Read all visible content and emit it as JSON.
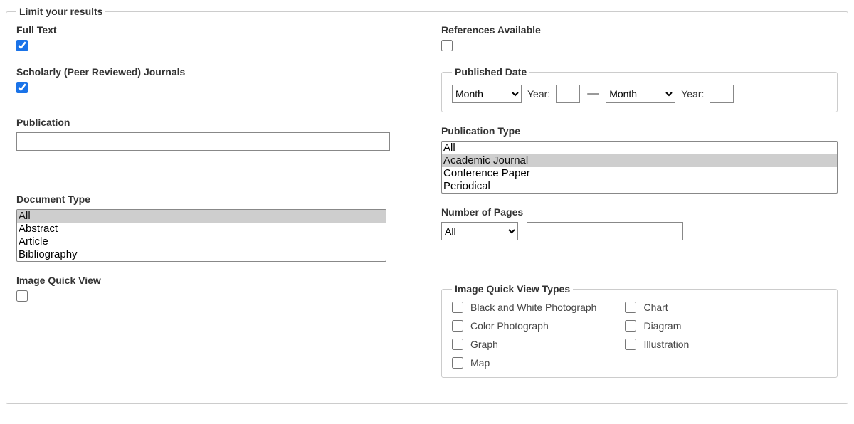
{
  "legend": "Limit your results",
  "left": {
    "fullText": {
      "label": "Full Text",
      "checked": true
    },
    "scholarly": {
      "label": "Scholarly (Peer Reviewed) Journals",
      "checked": true
    },
    "publication": {
      "label": "Publication",
      "value": ""
    },
    "documentType": {
      "label": "Document Type",
      "options": [
        "All",
        "Abstract",
        "Article",
        "Bibliography"
      ],
      "selected": "All"
    },
    "imageQuickView": {
      "label": "Image Quick View",
      "checked": false
    }
  },
  "right": {
    "referencesAvailable": {
      "label": "References Available",
      "checked": false
    },
    "publishedDate": {
      "legend": "Published Date",
      "monthPlaceholder": "Month",
      "yearLabel": "Year:",
      "separator": "—"
    },
    "publicationType": {
      "label": "Publication Type",
      "options": [
        "All",
        "Academic Journal",
        "Conference Paper",
        "Periodical"
      ],
      "selected": "Academic Journal"
    },
    "numberOfPages": {
      "label": "Number of Pages",
      "selectValue": "All",
      "inputValue": ""
    },
    "imageQuickViewTypes": {
      "legend": "Image Quick View Types",
      "col1": [
        {
          "label": "Black and White Photograph",
          "checked": false
        },
        {
          "label": "Color Photograph",
          "checked": false
        },
        {
          "label": "Graph",
          "checked": false
        },
        {
          "label": "Map",
          "checked": false
        }
      ],
      "col2": [
        {
          "label": "Chart",
          "checked": false
        },
        {
          "label": "Diagram",
          "checked": false
        },
        {
          "label": "Illustration",
          "checked": false
        }
      ]
    }
  }
}
